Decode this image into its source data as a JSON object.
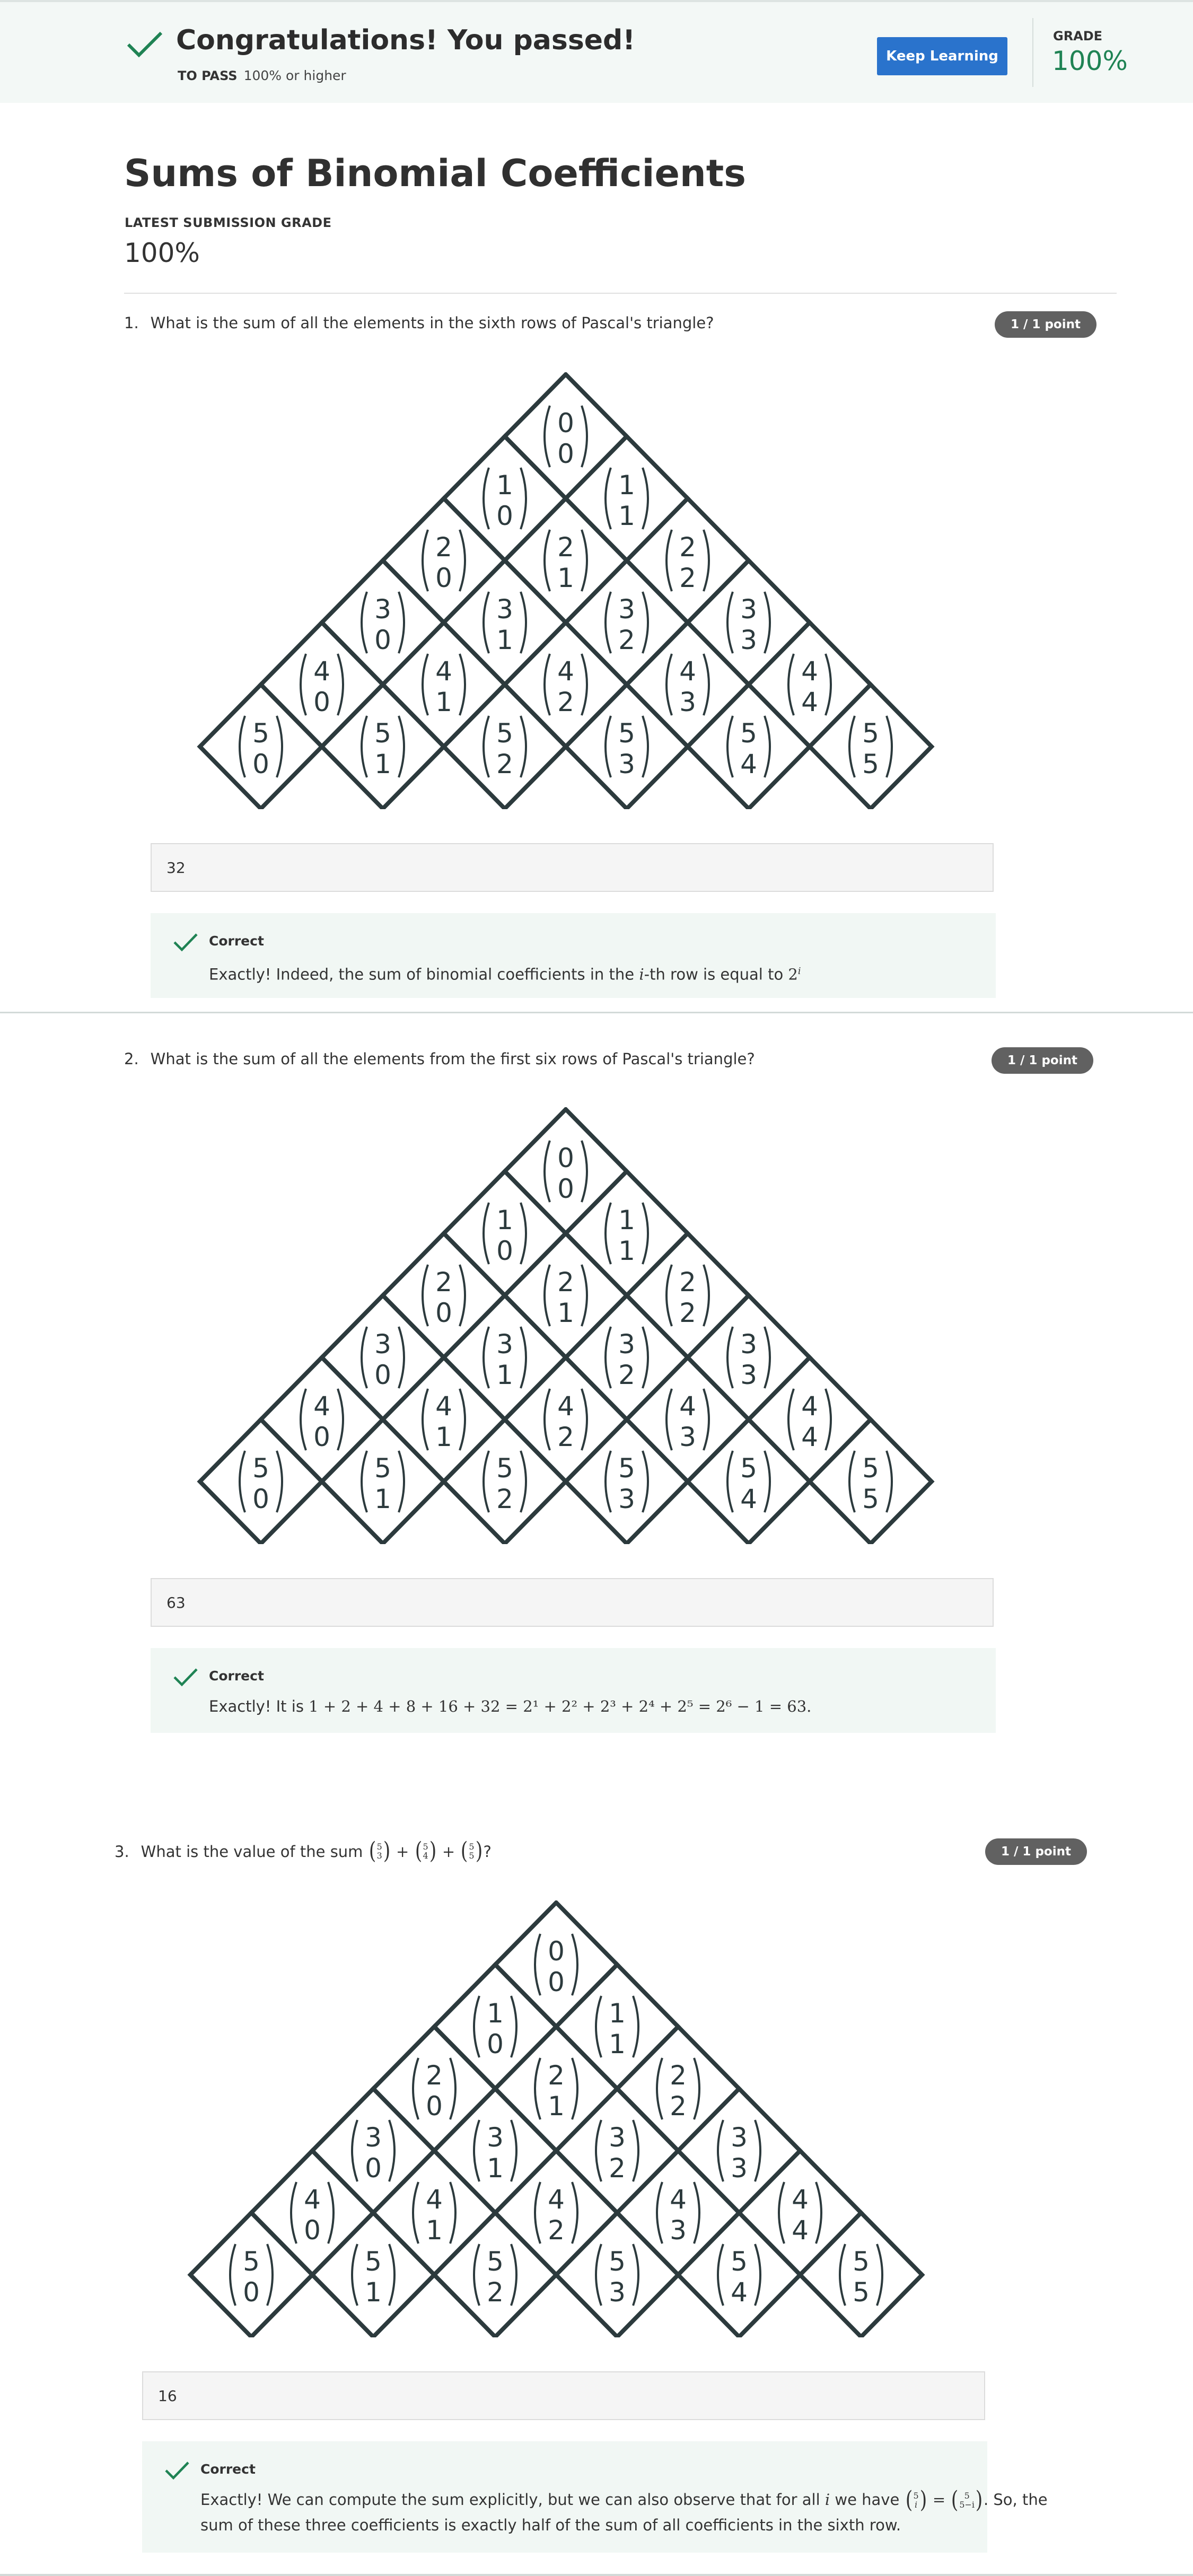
{
  "banner": {
    "message": "Congratulations! You passed!",
    "to_pass_label": "TO PASS",
    "to_pass_value": "100% or higher",
    "keep_learning_label": "Keep Learning",
    "grade_label": "GRADE",
    "grade_value": "100%",
    "accent_color": "#1f8354",
    "button_color": "#2a73cc"
  },
  "page": {
    "title": "Sums of Binomial Coefficients",
    "latest_grade_label": "LATEST SUBMISSION GRADE",
    "latest_grade_value": "100%"
  },
  "questions": [
    {
      "number": "1.",
      "text": "What is the sum of all the elements in the sixth rows of Pascal's triangle?",
      "points": "1 / 1 point",
      "answer": "32",
      "feedback_label": "Correct",
      "feedback_text_pre": "Exactly! Indeed, the sum of binomial coefficients in the ",
      "feedback_var": "i",
      "feedback_text_mid": "-th row is equal to ",
      "feedback_base": "2",
      "feedback_exp": "i"
    },
    {
      "number": "2.",
      "text": "What is the sum of all the elements from the first six rows of Pascal's triangle?",
      "points": "1 / 1 point",
      "answer": "63",
      "feedback_label": "Correct",
      "feedback_text_pre": "Exactly! It is ",
      "feedback_math": "1 + 2 + 4 + 8 + 16 + 32 = 2¹ + 2² + 2³ + 2⁴ + 2⁵ = 2⁶ − 1 = 63."
    },
    {
      "number": "3.",
      "text": "What is the value of the sum",
      "binom_terms": [
        [
          "5",
          "3"
        ],
        [
          "5",
          "4"
        ],
        [
          "5",
          "5"
        ]
      ],
      "question_end": "?",
      "points": "1 / 1 point",
      "answer": "16",
      "feedback_label": "Correct",
      "feedback_line1_pre": "Exactly! We can compute the sum explicitly, but we can also observe that for all ",
      "feedback_var": "i",
      "feedback_line1_mid": " we have ",
      "feedback_line1_post": ". So, the",
      "feedback_binom_left": [
        "5",
        "i"
      ],
      "feedback_binom_right": [
        "5",
        "5−i"
      ],
      "feedback_line2": "sum of these three coefficients is exactly half of the sum of all coefficients in the sixth row."
    }
  ],
  "pascal_triangle": {
    "rows": [
      [
        [
          "0",
          "0"
        ]
      ],
      [
        [
          "1",
          "0"
        ],
        [
          "1",
          "1"
        ]
      ],
      [
        [
          "2",
          "0"
        ],
        [
          "2",
          "1"
        ],
        [
          "2",
          "2"
        ]
      ],
      [
        [
          "3",
          "0"
        ],
        [
          "3",
          "1"
        ],
        [
          "3",
          "2"
        ],
        [
          "3",
          "3"
        ]
      ],
      [
        [
          "4",
          "0"
        ],
        [
          "4",
          "1"
        ],
        [
          "4",
          "2"
        ],
        [
          "4",
          "3"
        ],
        [
          "4",
          "4"
        ]
      ],
      [
        [
          "5",
          "0"
        ],
        [
          "5",
          "1"
        ],
        [
          "5",
          "2"
        ],
        [
          "5",
          "3"
        ],
        [
          "5",
          "4"
        ],
        [
          "5",
          "5"
        ]
      ]
    ]
  }
}
